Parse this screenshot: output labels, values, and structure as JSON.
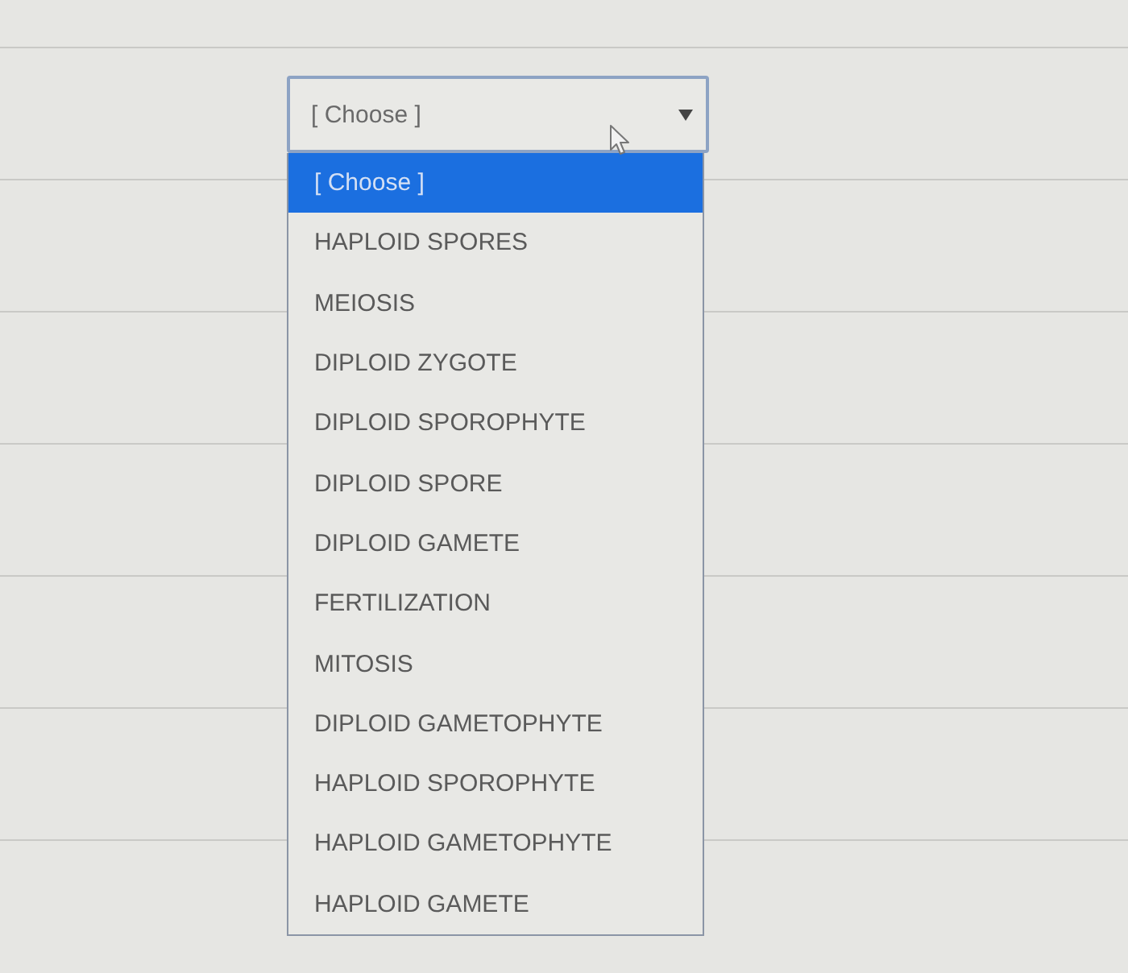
{
  "select": {
    "value": "[ Choose ]",
    "expanded": true
  },
  "options": [
    {
      "label": "[ Choose ]",
      "selected": true
    },
    {
      "label": "HAPLOID SPORES",
      "selected": false
    },
    {
      "label": "MEIOSIS",
      "selected": false
    },
    {
      "label": "DIPLOID ZYGOTE",
      "selected": false
    },
    {
      "label": "DIPLOID SPOROPHYTE",
      "selected": false
    },
    {
      "label": "DIPLOID SPORE",
      "selected": false
    },
    {
      "label": "DIPLOID GAMETE",
      "selected": false
    },
    {
      "label": "FERTILIZATION",
      "selected": false
    },
    {
      "label": "MITOSIS",
      "selected": false
    },
    {
      "label": "DIPLOID GAMETOPHYTE",
      "selected": false
    },
    {
      "label": "HAPLOID SPOROPHYTE",
      "selected": false
    },
    {
      "label": "HAPLOID GAMETOPHYTE",
      "selected": false
    },
    {
      "label": "HAPLOID GAMETE",
      "selected": false
    }
  ]
}
